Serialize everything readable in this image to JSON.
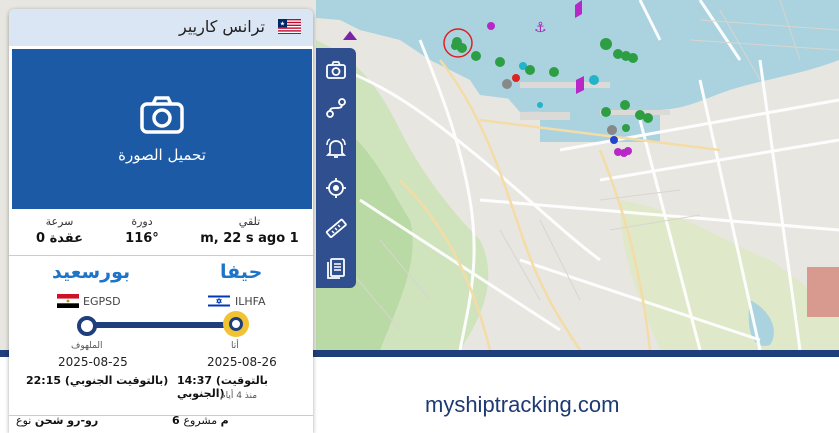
{
  "panel": {
    "title": "ترانس كاريير",
    "flag_country": "Liberia",
    "close_icon": "close-icon",
    "upload_label": "تحميل الصورة",
    "stats": {
      "speed_label": "سرعة",
      "speed_value": "0 عقدة",
      "course_label": "دورة",
      "course_value": "116°",
      "received_label": "تلقي",
      "received_value": "m, 22 s ago 1"
    },
    "route": {
      "departure_port": "بورسعيد",
      "departure_code": "EGPSD",
      "arrival_port": "حيفا",
      "arrival_code": "ILHFA",
      "departure_status": "الملهوف",
      "departure_date": "2025-08-25",
      "departure_time": "22:15 (بالتوقيت الجنوبي)",
      "arrival_status": "أتا",
      "arrival_date": "2025-08-26",
      "arrival_time": "14:37 (بالتوقيت الجنوبي)",
      "arrival_ago": "منذ 4 أيام"
    },
    "info": {
      "type_label": "نوع",
      "type_value": "رو-رو شحن",
      "draught_label": "مشروع",
      "draught_value": "6 م"
    }
  },
  "toolbar": {
    "icons": [
      "camera-icon",
      "route-icon",
      "bell-icon",
      "target-icon",
      "ruler-icon",
      "document-icon"
    ]
  },
  "footer": {
    "site": "myshiptracking.com"
  },
  "colors": {
    "accent": "#1f3e7c",
    "photo_bg": "#1c5aa6",
    "port_blue": "#1d74c9",
    "water": "#aad3df",
    "progress_dot": "#f1c232"
  }
}
